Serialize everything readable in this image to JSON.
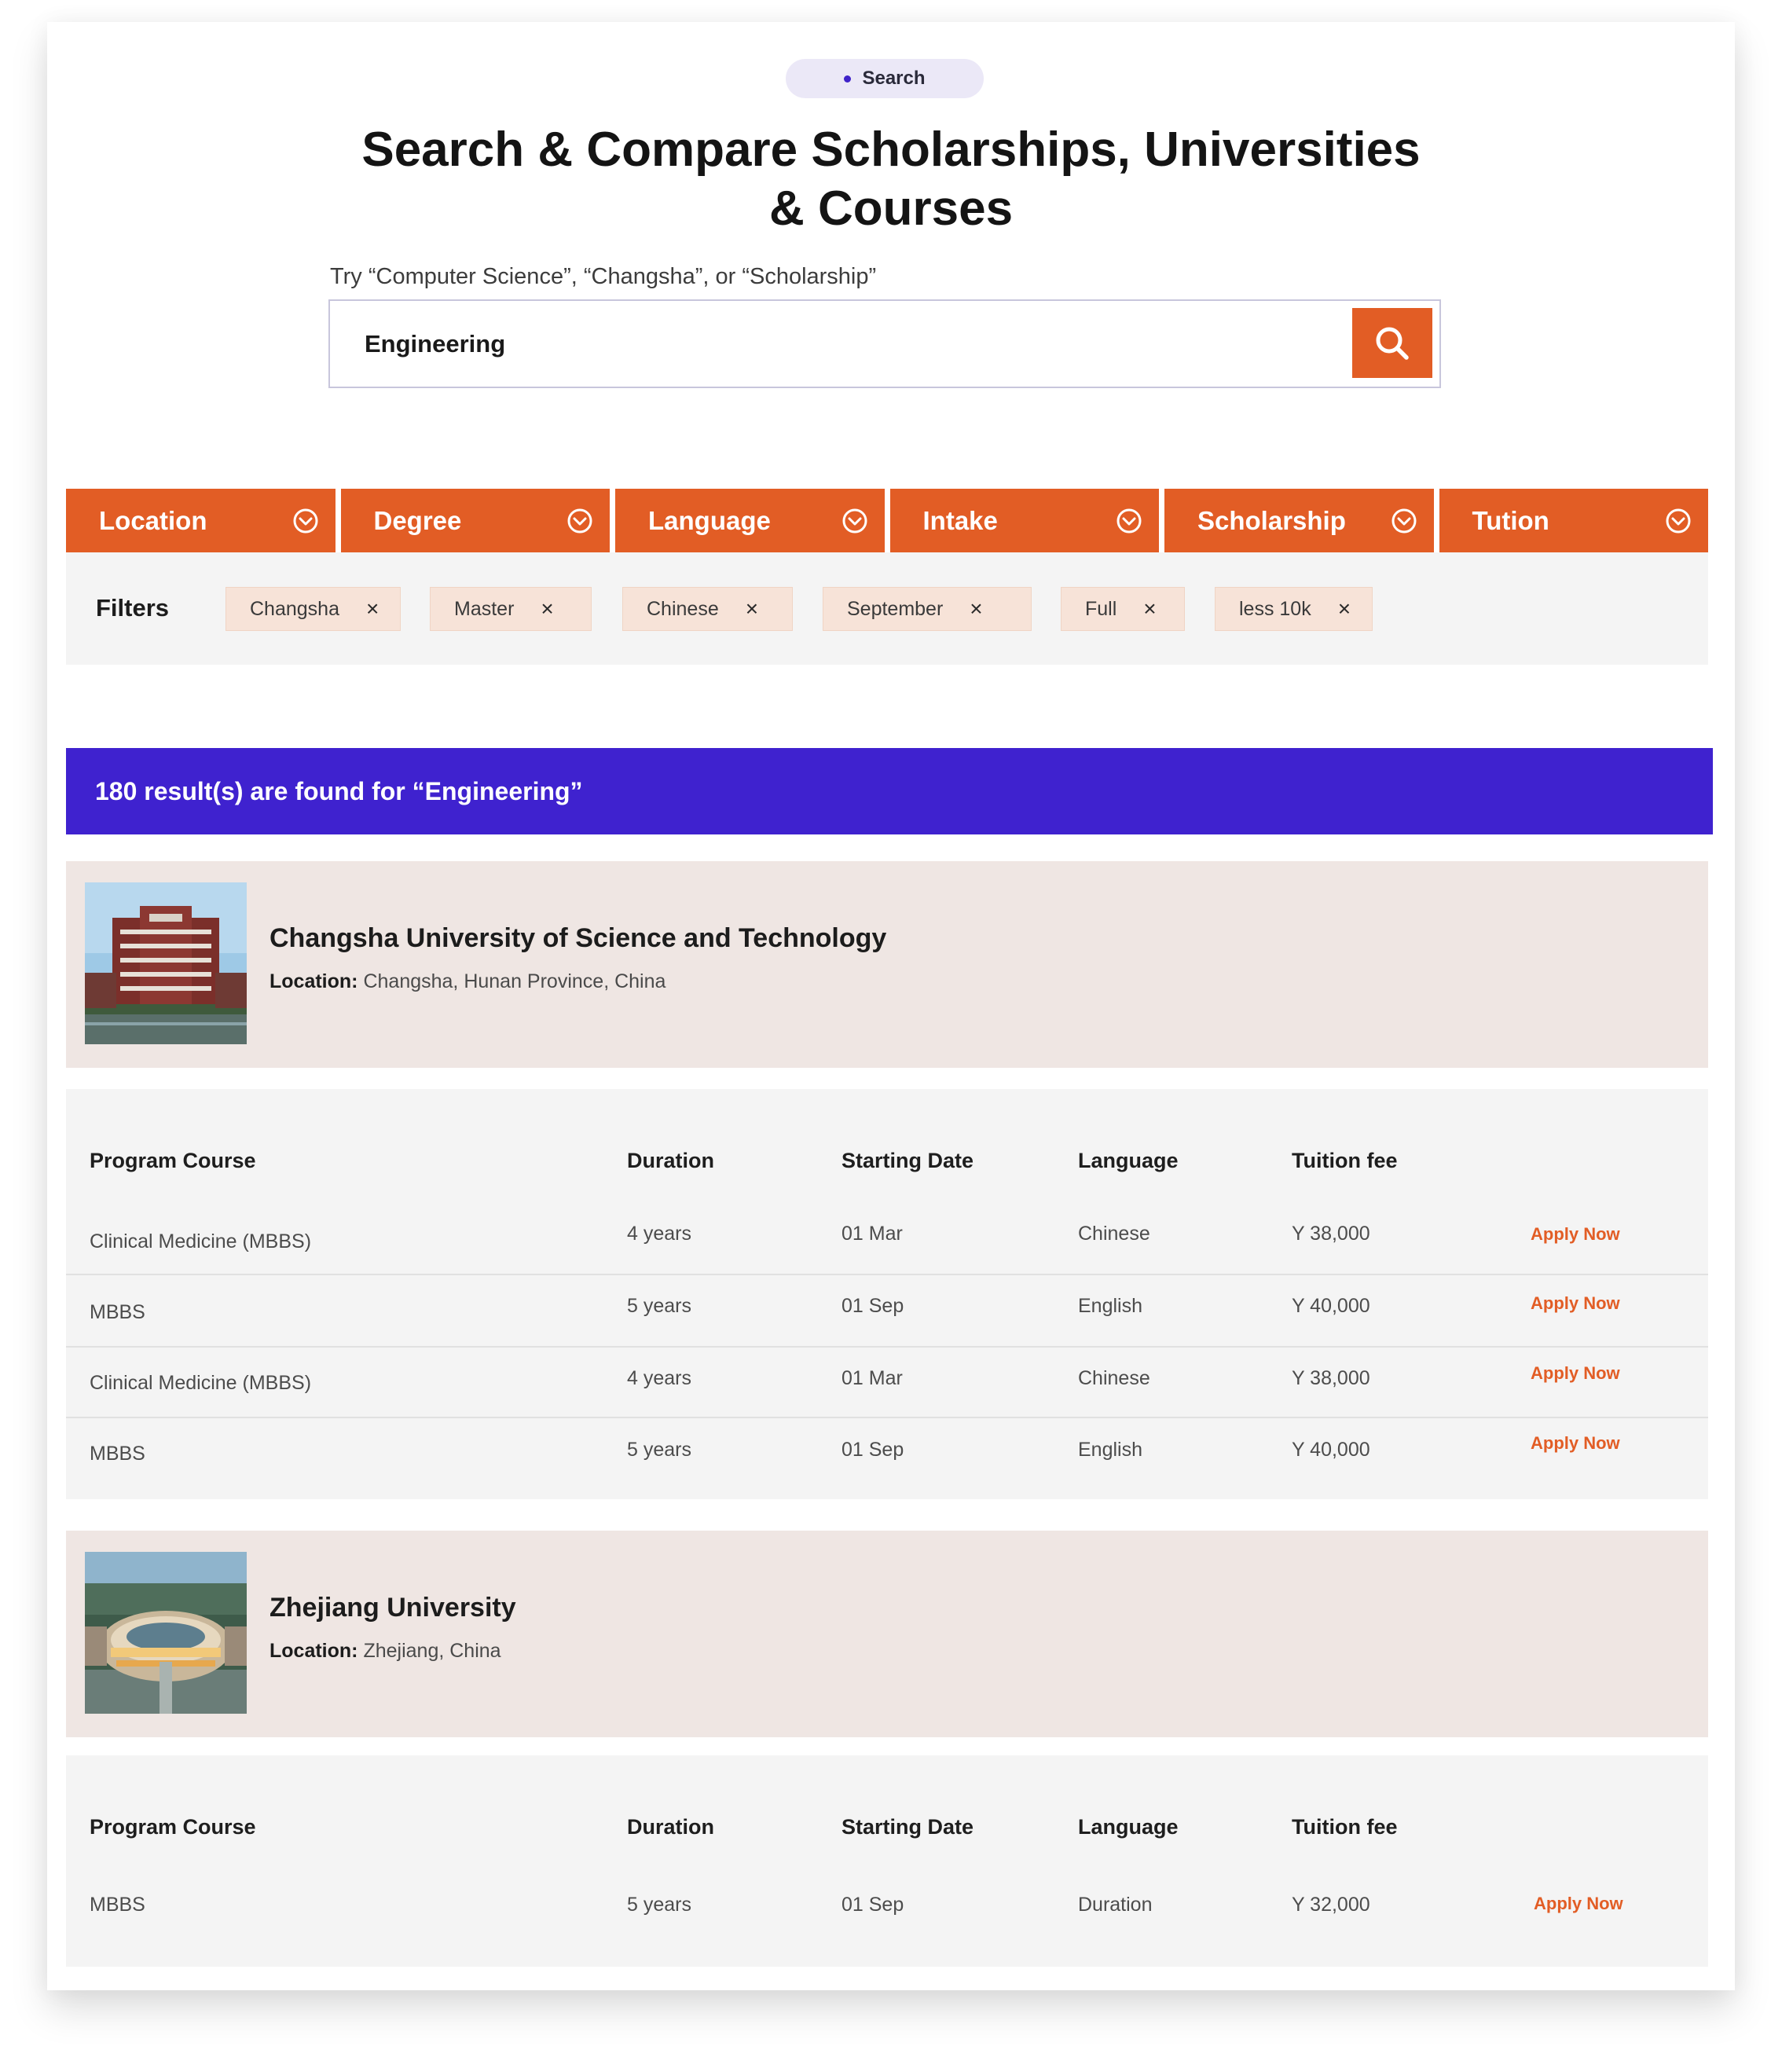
{
  "badge": {
    "label": "Search"
  },
  "hero": {
    "title_line1": "Search & Compare Scholarships, Universities",
    "title_line2": "& Courses",
    "hint": "Try “Computer Science”, “Changsha”, or “Scholarship”"
  },
  "search": {
    "value": "Engineering",
    "icon": "search-icon"
  },
  "dropdowns": [
    {
      "label": "Location"
    },
    {
      "label": "Degree"
    },
    {
      "label": "Language"
    },
    {
      "label": "Intake"
    },
    {
      "label": "Scholarship"
    },
    {
      "label": "Tution"
    }
  ],
  "filters": {
    "label": "Filters",
    "chips": [
      {
        "label": "Changsha"
      },
      {
        "label": "Master"
      },
      {
        "label": "Chinese"
      },
      {
        "label": "September"
      },
      {
        "label": "Full"
      },
      {
        "label": "less 10k"
      }
    ]
  },
  "results": {
    "text": "180 result(s) are found for “Engineering”"
  },
  "columns": {
    "course": "Program Course",
    "duration": "Duration",
    "start": "Starting Date",
    "language": "Language",
    "fee": "Tuition fee"
  },
  "universities": [
    {
      "name": "Changsha University of Science and Technology",
      "location_label": "Location:",
      "location": "Changsha, Hunan Province, China",
      "courses": [
        {
          "course": "Clinical Medicine (MBBS)",
          "duration": "4 years",
          "start": "01 Mar",
          "language": "Chinese",
          "fee": "Y 38,000",
          "action": "Apply Now"
        },
        {
          "course": "MBBS",
          "duration": "5 years",
          "start": "01 Sep",
          "language": "English",
          "fee": "Y 40,000",
          "action": "Apply Now"
        },
        {
          "course": "Clinical Medicine (MBBS)",
          "duration": "4 years",
          "start": "01 Mar",
          "language": "Chinese",
          "fee": "Y 38,000",
          "action": "Apply Now"
        },
        {
          "course": "MBBS",
          "duration": "5 years",
          "start": "01 Sep",
          "language": "English",
          "fee": "Y 40,000",
          "action": "Apply Now"
        }
      ]
    },
    {
      "name": "Zhejiang University",
      "location_label": "Location:",
      "location": "Zhejiang, China",
      "courses": [
        {
          "course": "MBBS",
          "duration": "5 years",
          "start": "01 Sep",
          "language": "Duration",
          "fee": "Y 32,000",
          "action": "Apply Now"
        }
      ]
    }
  ],
  "colors": {
    "accent": "#e25d25",
    "results_bar": "#3f22cf",
    "card_bg": "#efe6e3",
    "panel_bg": "#f4f4f4"
  }
}
